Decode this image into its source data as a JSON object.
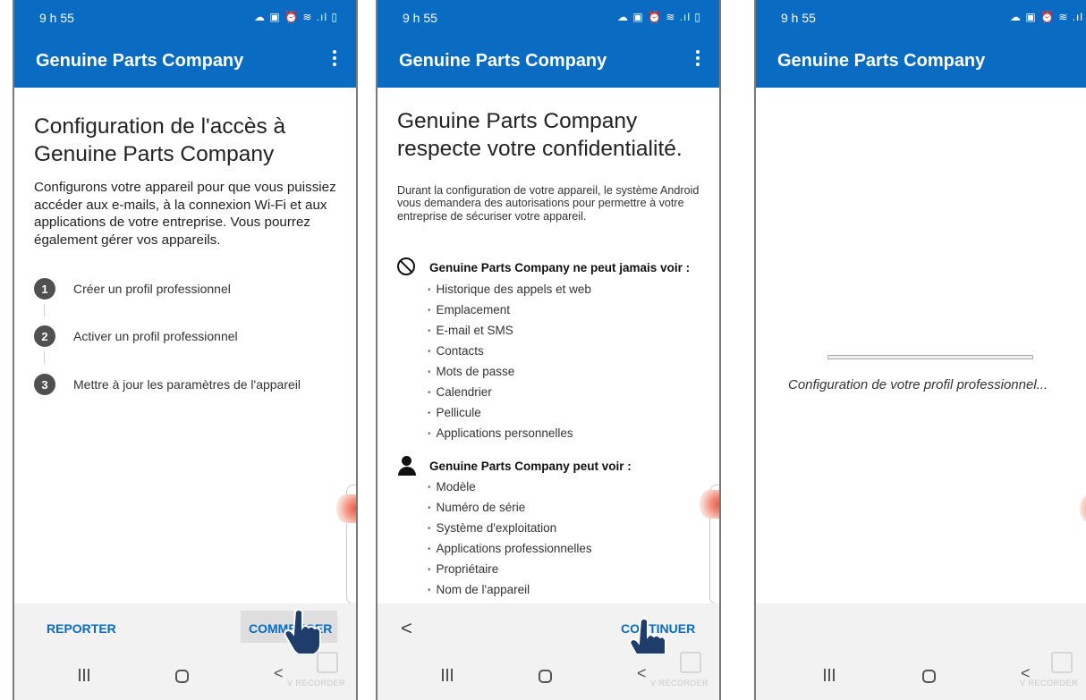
{
  "status_bar": {
    "time": "9 h 55",
    "icons": "☁ ▣  ⏰ ≋ .ıl ▯"
  },
  "app_bar": {
    "title": "Genuine Parts Company"
  },
  "screen1": {
    "heading": "Configuration de l'accès à Genuine Parts Company",
    "intro": "Configurons votre appareil pour que vous puissiez accéder aux e-mails, à la connexion Wi-Fi et aux applications de votre entreprise. Vous pourrez également gérer vos appareils.",
    "steps": [
      {
        "num": "1",
        "label": "Créer un profil professionnel"
      },
      {
        "num": "2",
        "label": "Activer un profil professionnel"
      },
      {
        "num": "3",
        "label": "Mettre à jour les paramètres de l'appareil"
      }
    ],
    "postpone_label": "REPORTER",
    "start_label": "COMMENCER"
  },
  "screen2": {
    "heading": "Genuine Parts Company respecte votre confidentialité.",
    "intro": "Durant la configuration de votre appareil, le système Android vous demandera des autorisations pour permettre à votre entreprise de sécuriser votre appareil.",
    "cannot_see_title": "Genuine Parts Company ne peut jamais voir :",
    "cannot_see": [
      "Historique des appels et web",
      "Emplacement",
      "E-mail et SMS",
      "Contacts",
      "Mots de passe",
      "Calendrier",
      "Pellicule",
      "Applications personnelles"
    ],
    "can_see_title": "Genuine Parts Company peut voir :",
    "can_see": [
      "Modèle",
      "Numéro de série",
      "Système d'exploitation",
      "Applications professionnelles",
      "Propriétaire",
      "Nom de l'appareil"
    ],
    "back_glyph": "<",
    "continue_label": "CONTINUER"
  },
  "screen3": {
    "loading_text": "Configuration de votre profil professionnel..."
  },
  "nav": {
    "back_glyph": "<"
  },
  "watermark": "V RECORDER",
  "colors": {
    "brand_blue": "#0a6bc2",
    "bottom_bar": "#f2f2f2",
    "touch_indicator": "#e85a44"
  }
}
